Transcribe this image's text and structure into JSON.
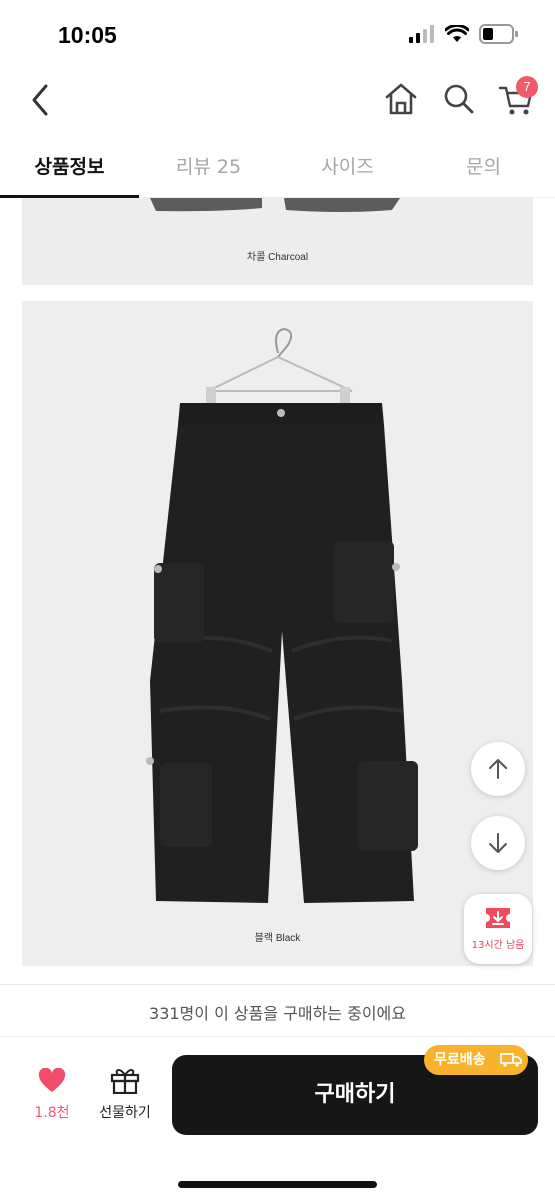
{
  "status": {
    "time": "10:05"
  },
  "nav": {
    "cart_count": "7"
  },
  "tabs": [
    {
      "label": "상품정보"
    },
    {
      "label": "리뷰 25"
    },
    {
      "label": "사이즈"
    },
    {
      "label": "문의"
    }
  ],
  "product": {
    "caption_charcoal": "차콜 Charcoal",
    "caption_black": "블랙 Black"
  },
  "coupon": {
    "label": "13시간 남음"
  },
  "notice": "331명이 이 상품을 구매하는 중이에요",
  "bottom": {
    "like_count": "1.8천",
    "gift_label": "선물하기",
    "buy_label": "구매하기",
    "ship_badge": "무료배송"
  },
  "colors": {
    "accent": "#f25a6a",
    "ship": "#f7b32b",
    "buy_bg": "#161616"
  }
}
